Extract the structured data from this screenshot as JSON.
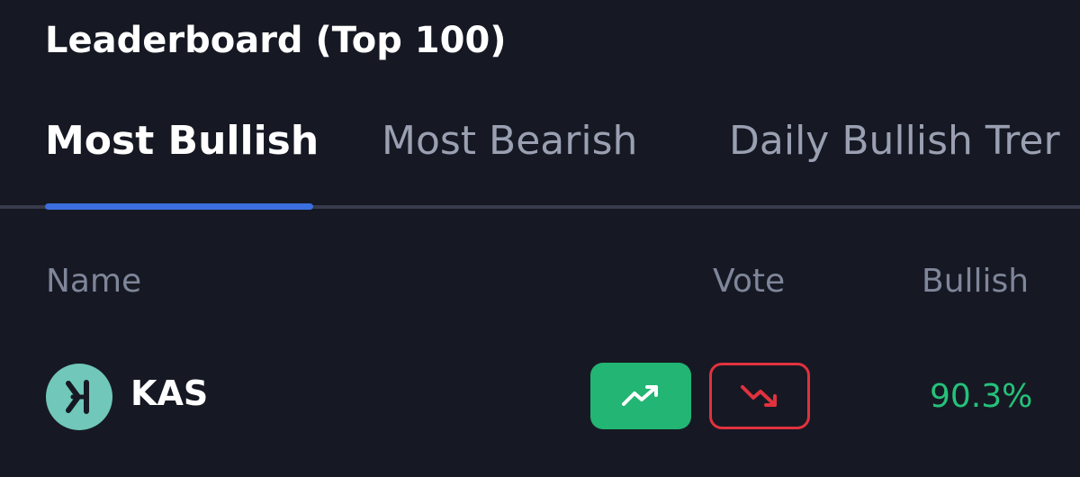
{
  "header": {
    "title": "Leaderboard (Top 100)"
  },
  "tabs": [
    {
      "label": "Most Bullish",
      "active": true
    },
    {
      "label": "Most Bearish",
      "active": false
    },
    {
      "label": "Daily Bullish Trer",
      "active": false
    }
  ],
  "table": {
    "columns": [
      "Name",
      "Vote",
      "Bullish"
    ],
    "rows": [
      {
        "icon": "kaspa-logo-icon",
        "symbol": "KAS",
        "vote_up_icon": "trending-up-icon",
        "vote_down_icon": "trending-down-icon",
        "bullish": "90.3%"
      }
    ]
  },
  "colors": {
    "background": "#161923",
    "accent": "#3b6fe0",
    "bullish_green": "#22b573",
    "bearish_red": "#e0323e",
    "kaspa_teal": "#70c7ba"
  }
}
